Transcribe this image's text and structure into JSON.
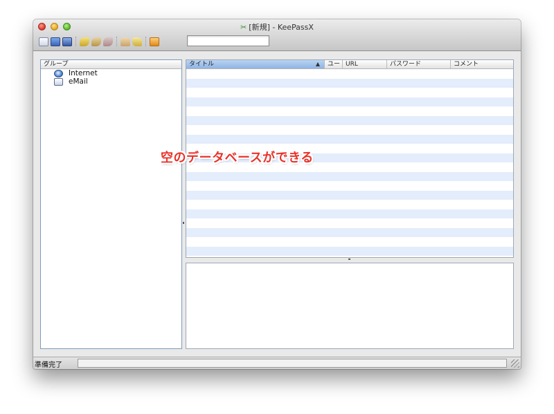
{
  "window": {
    "title": "[新規] - KeePassX",
    "app_icon": "keepassx-icon"
  },
  "toolbar": {
    "buttons": [
      {
        "name": "new-database",
        "icon": "new-doc-icon"
      },
      {
        "name": "open-database",
        "icon": "open-folder-icon"
      },
      {
        "name": "save-database",
        "icon": "save-icon"
      },
      {
        "name": "add-entry",
        "icon": "key-add-icon"
      },
      {
        "name": "edit-entry",
        "icon": "key-edit-icon"
      },
      {
        "name": "delete-entry",
        "icon": "key-delete-icon"
      },
      {
        "name": "copy-username",
        "icon": "user-icon"
      },
      {
        "name": "copy-password",
        "icon": "pen-icon"
      },
      {
        "name": "lock-workspace",
        "icon": "lock-icon"
      }
    ],
    "search_value": ""
  },
  "groups": {
    "header": "グループ",
    "items": [
      {
        "label": "Internet",
        "icon": "globe-icon"
      },
      {
        "label": "eMail",
        "icon": "mail-icon"
      }
    ]
  },
  "entries": {
    "columns": [
      "タイトル",
      "ユー",
      "URL",
      "パスワード",
      "コメント"
    ],
    "sorted_column": "タイトル",
    "sort_direction": "ascending",
    "rows": []
  },
  "annotation": {
    "text": "空のデータベースができる",
    "color": "#e8332a"
  },
  "status": {
    "text": "準備完了"
  }
}
